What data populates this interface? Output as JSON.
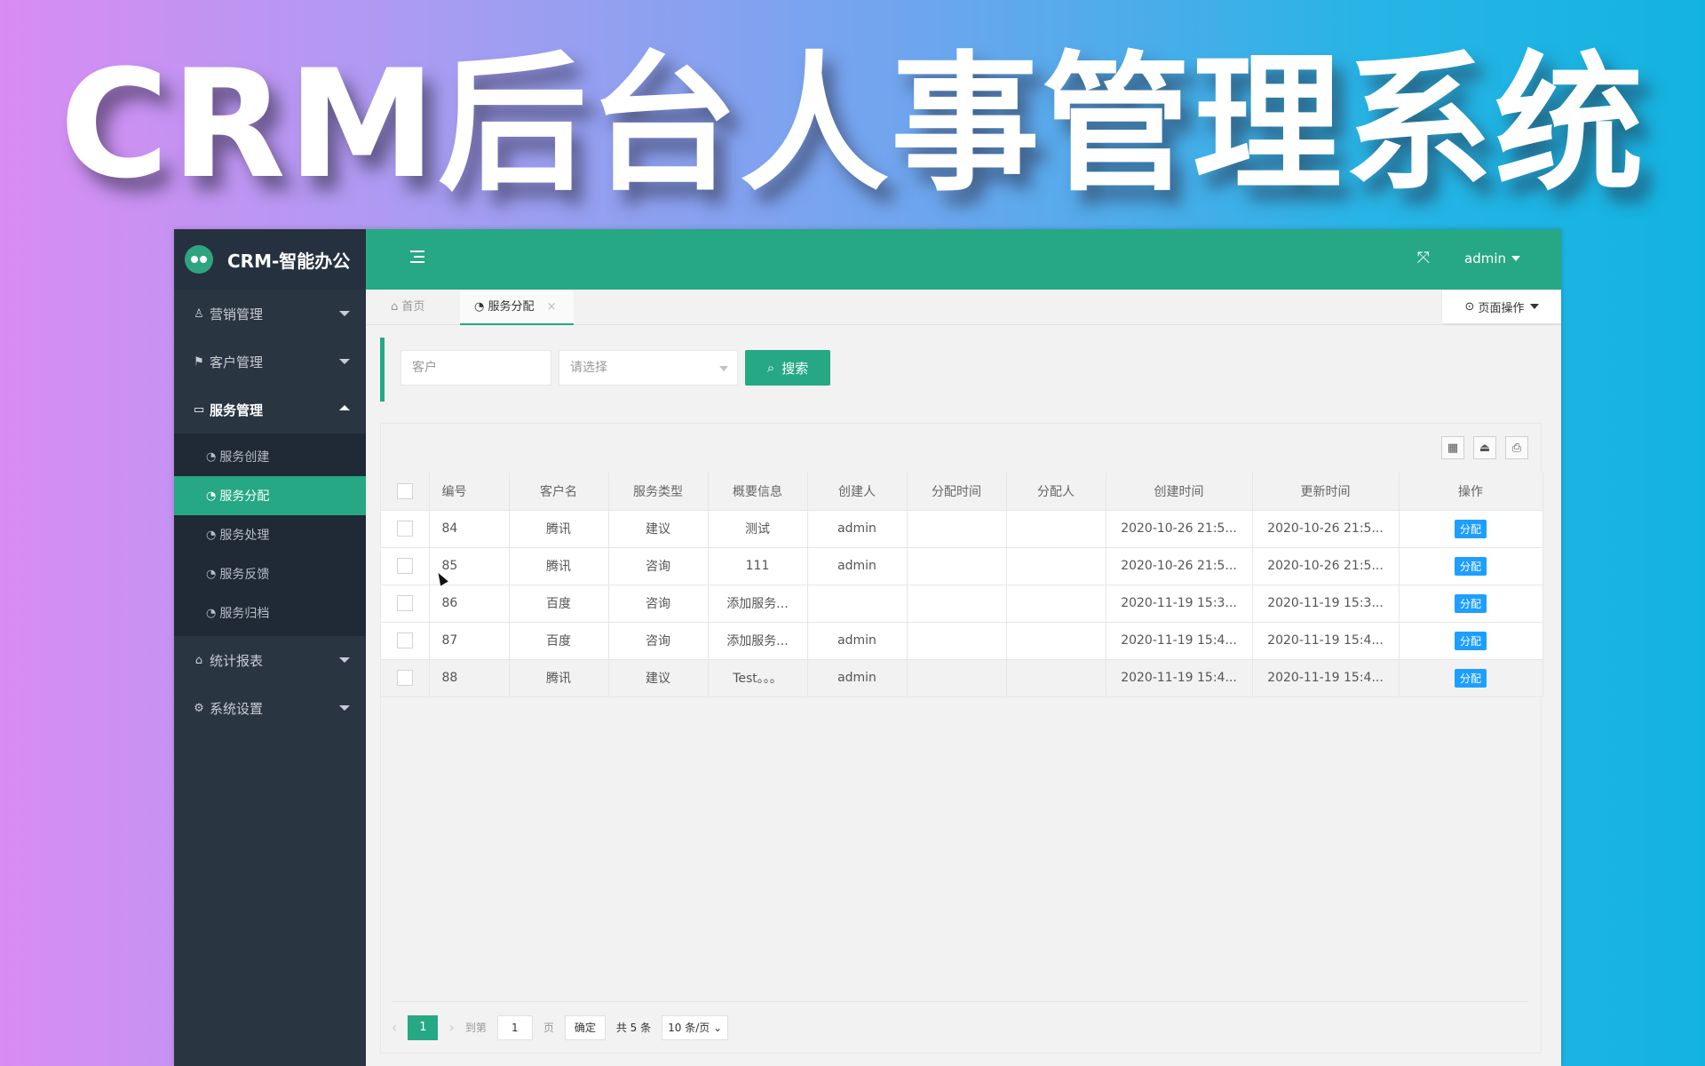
{
  "banner": {
    "title": "CRM后台人事管理系统"
  },
  "app": {
    "logo_text": "CRM-智能办公",
    "user": "admin",
    "sidebar": [
      {
        "label": "营销管理",
        "icon": "person-icon",
        "glyph": "♙"
      },
      {
        "label": "客户管理",
        "icon": "flag-icon",
        "glyph": "⚑"
      },
      {
        "label": "服务管理",
        "icon": "monitor-icon",
        "glyph": "▭"
      },
      {
        "label": "统计报表",
        "icon": "home-icon",
        "glyph": "⌂"
      },
      {
        "label": "系统设置",
        "icon": "gears-icon",
        "glyph": "⚙"
      }
    ],
    "submenu": [
      {
        "label": "服务创建"
      },
      {
        "label": "服务分配"
      },
      {
        "label": "服务处理"
      },
      {
        "label": "服务反馈"
      },
      {
        "label": "服务归档"
      }
    ],
    "tabs": {
      "home": "首页",
      "current": "服务分配",
      "page_ops": "页面操作"
    },
    "search": {
      "customer_placeholder": "客户",
      "select_placeholder": "请选择",
      "button": "搜索"
    },
    "table": {
      "headers": [
        "编号",
        "客户名",
        "服务类型",
        "概要信息",
        "创建人",
        "分配时间",
        "分配人",
        "创建时间",
        "更新时间",
        "操作"
      ],
      "rows": [
        {
          "id": "84",
          "customer": "腾讯",
          "type": "建议",
          "summary": "测试",
          "creator": "admin",
          "assign_time": "",
          "assignee": "",
          "created": "2020-10-26 21:5...",
          "updated": "2020-10-26 21:5...",
          "action": "分配"
        },
        {
          "id": "85",
          "customer": "腾讯",
          "type": "咨询",
          "summary": "111",
          "creator": "admin",
          "assign_time": "",
          "assignee": "",
          "created": "2020-10-26 21:5...",
          "updated": "2020-10-26 21:5...",
          "action": "分配"
        },
        {
          "id": "86",
          "customer": "百度",
          "type": "咨询",
          "summary": "添加服务...",
          "creator": "",
          "assign_time": "",
          "assignee": "",
          "created": "2020-11-19 15:3...",
          "updated": "2020-11-19 15:3...",
          "action": "分配"
        },
        {
          "id": "87",
          "customer": "百度",
          "type": "咨询",
          "summary": "添加服务...",
          "creator": "admin",
          "assign_time": "",
          "assignee": "",
          "created": "2020-11-19 15:4...",
          "updated": "2020-11-19 15:4...",
          "action": "分配"
        },
        {
          "id": "88",
          "customer": "腾讯",
          "type": "建议",
          "summary": "Test。。。",
          "creator": "admin",
          "assign_time": "",
          "assignee": "",
          "created": "2020-11-19 15:4...",
          "updated": "2020-11-19 15:4...",
          "action": "分配"
        }
      ]
    },
    "pager": {
      "current_page": "1",
      "goto_label": "到第",
      "goto_value": "1",
      "page_unit": "页",
      "confirm": "确定",
      "total": "共 5 条",
      "page_size": "10 条/页"
    },
    "colors": {
      "accent": "#26a884",
      "sidebar": "#2a3542",
      "assign_button": "#1e9fff"
    }
  }
}
